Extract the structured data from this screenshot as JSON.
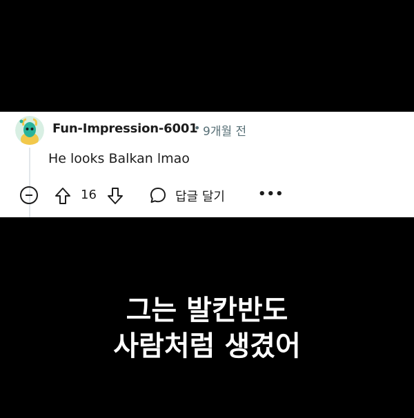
{
  "comment": {
    "username": "Fun-Impression-6001",
    "separator": "•",
    "timestamp": "9개월 전",
    "text": "He looks Balkan lmao",
    "vote_count": "16",
    "reply_label": "답글 달기",
    "more_label": "•••"
  },
  "subtitle": {
    "line1": "그는 발칸반도",
    "line2": "사람처럼 생겼어"
  },
  "colors": {
    "background": "#000000",
    "card": "#ffffff",
    "text": "#1c1c1c",
    "meta": "#576f76",
    "avatar_bg": "#c9ead6",
    "avatar_figure": "#2ab39a"
  },
  "icons": {
    "avatar": "snoo-avatar",
    "collapse": "collapse-minus-circle-icon",
    "upvote": "upvote-arrow-icon",
    "downvote": "downvote-arrow-icon",
    "reply": "comment-bubble-icon",
    "more": "more-options-icon"
  }
}
